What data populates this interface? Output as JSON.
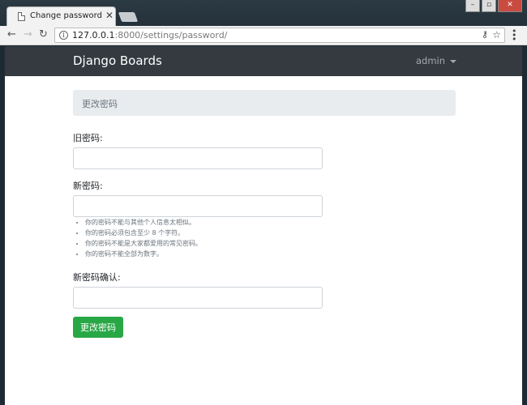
{
  "browser": {
    "tab_title": "Change password",
    "url_host": "127.0.0.1",
    "url_rest": ":8000/settings/password/"
  },
  "navbar": {
    "brand": "Django Boards",
    "user": "admin"
  },
  "breadcrumb": {
    "active": "更改密码"
  },
  "form": {
    "old_password_label": "旧密码:",
    "old_password_value": "",
    "new_password1_label": "新密码:",
    "new_password1_value": "",
    "help_items": [
      "你的密码不能与其他个人信息太相似。",
      "你的密码必须包含至少 8 个字符。",
      "你的密码不能是大家都爱用的常见密码。",
      "你的密码不能全部为数字。"
    ],
    "new_password2_label": "新密码确认:",
    "new_password2_value": "",
    "submit_label": "更改密码"
  },
  "colors": {
    "navbar_bg": "#343a40",
    "breadcrumb_bg": "#e9ecef",
    "submit_bg": "#28a745"
  }
}
